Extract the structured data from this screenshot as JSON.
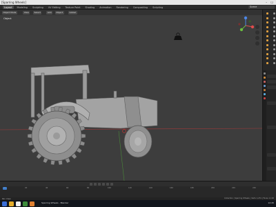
{
  "window": {
    "title": "[Sparring Wheels]",
    "controls": "– ☐ ✕"
  },
  "menubar": {
    "tabs": [
      "Layout",
      "Modeling",
      "Sculpting",
      "UV Editing",
      "Texture Paint",
      "Shading",
      "Animation",
      "Rendering",
      "Compositing",
      "Scripting"
    ],
    "active_tab": "Layout",
    "scene_label": "Scene"
  },
  "viewport": {
    "header_buttons": [
      "Object Mode",
      "View",
      "Select",
      "Add",
      "Object",
      "Global"
    ],
    "label": "Object",
    "background": "#3d3d3d",
    "gizmo_axes": {
      "x": "#e04c4c",
      "y": "#6bbf3f",
      "z": "#4d87e8"
    }
  },
  "outliner": {
    "row_count": 12
  },
  "timeline": {
    "frame_ticks": [
      "0",
      "20",
      "40",
      "60",
      "80",
      "100",
      "120",
      "140",
      "160",
      "180",
      "200",
      "220",
      "240"
    ],
    "current_frame": "1"
  },
  "statusbar": {
    "left": "Pan View",
    "right": "Collection | Sparring Wheels | Verts 1,231 | Faces 1,102"
  },
  "taskbar": {
    "app_label": "Sparring Wheels - Blender",
    "time": "12:45"
  },
  "colors": {
    "accent": "#3d7dcc",
    "outliner_icon": "#e0a040"
  }
}
